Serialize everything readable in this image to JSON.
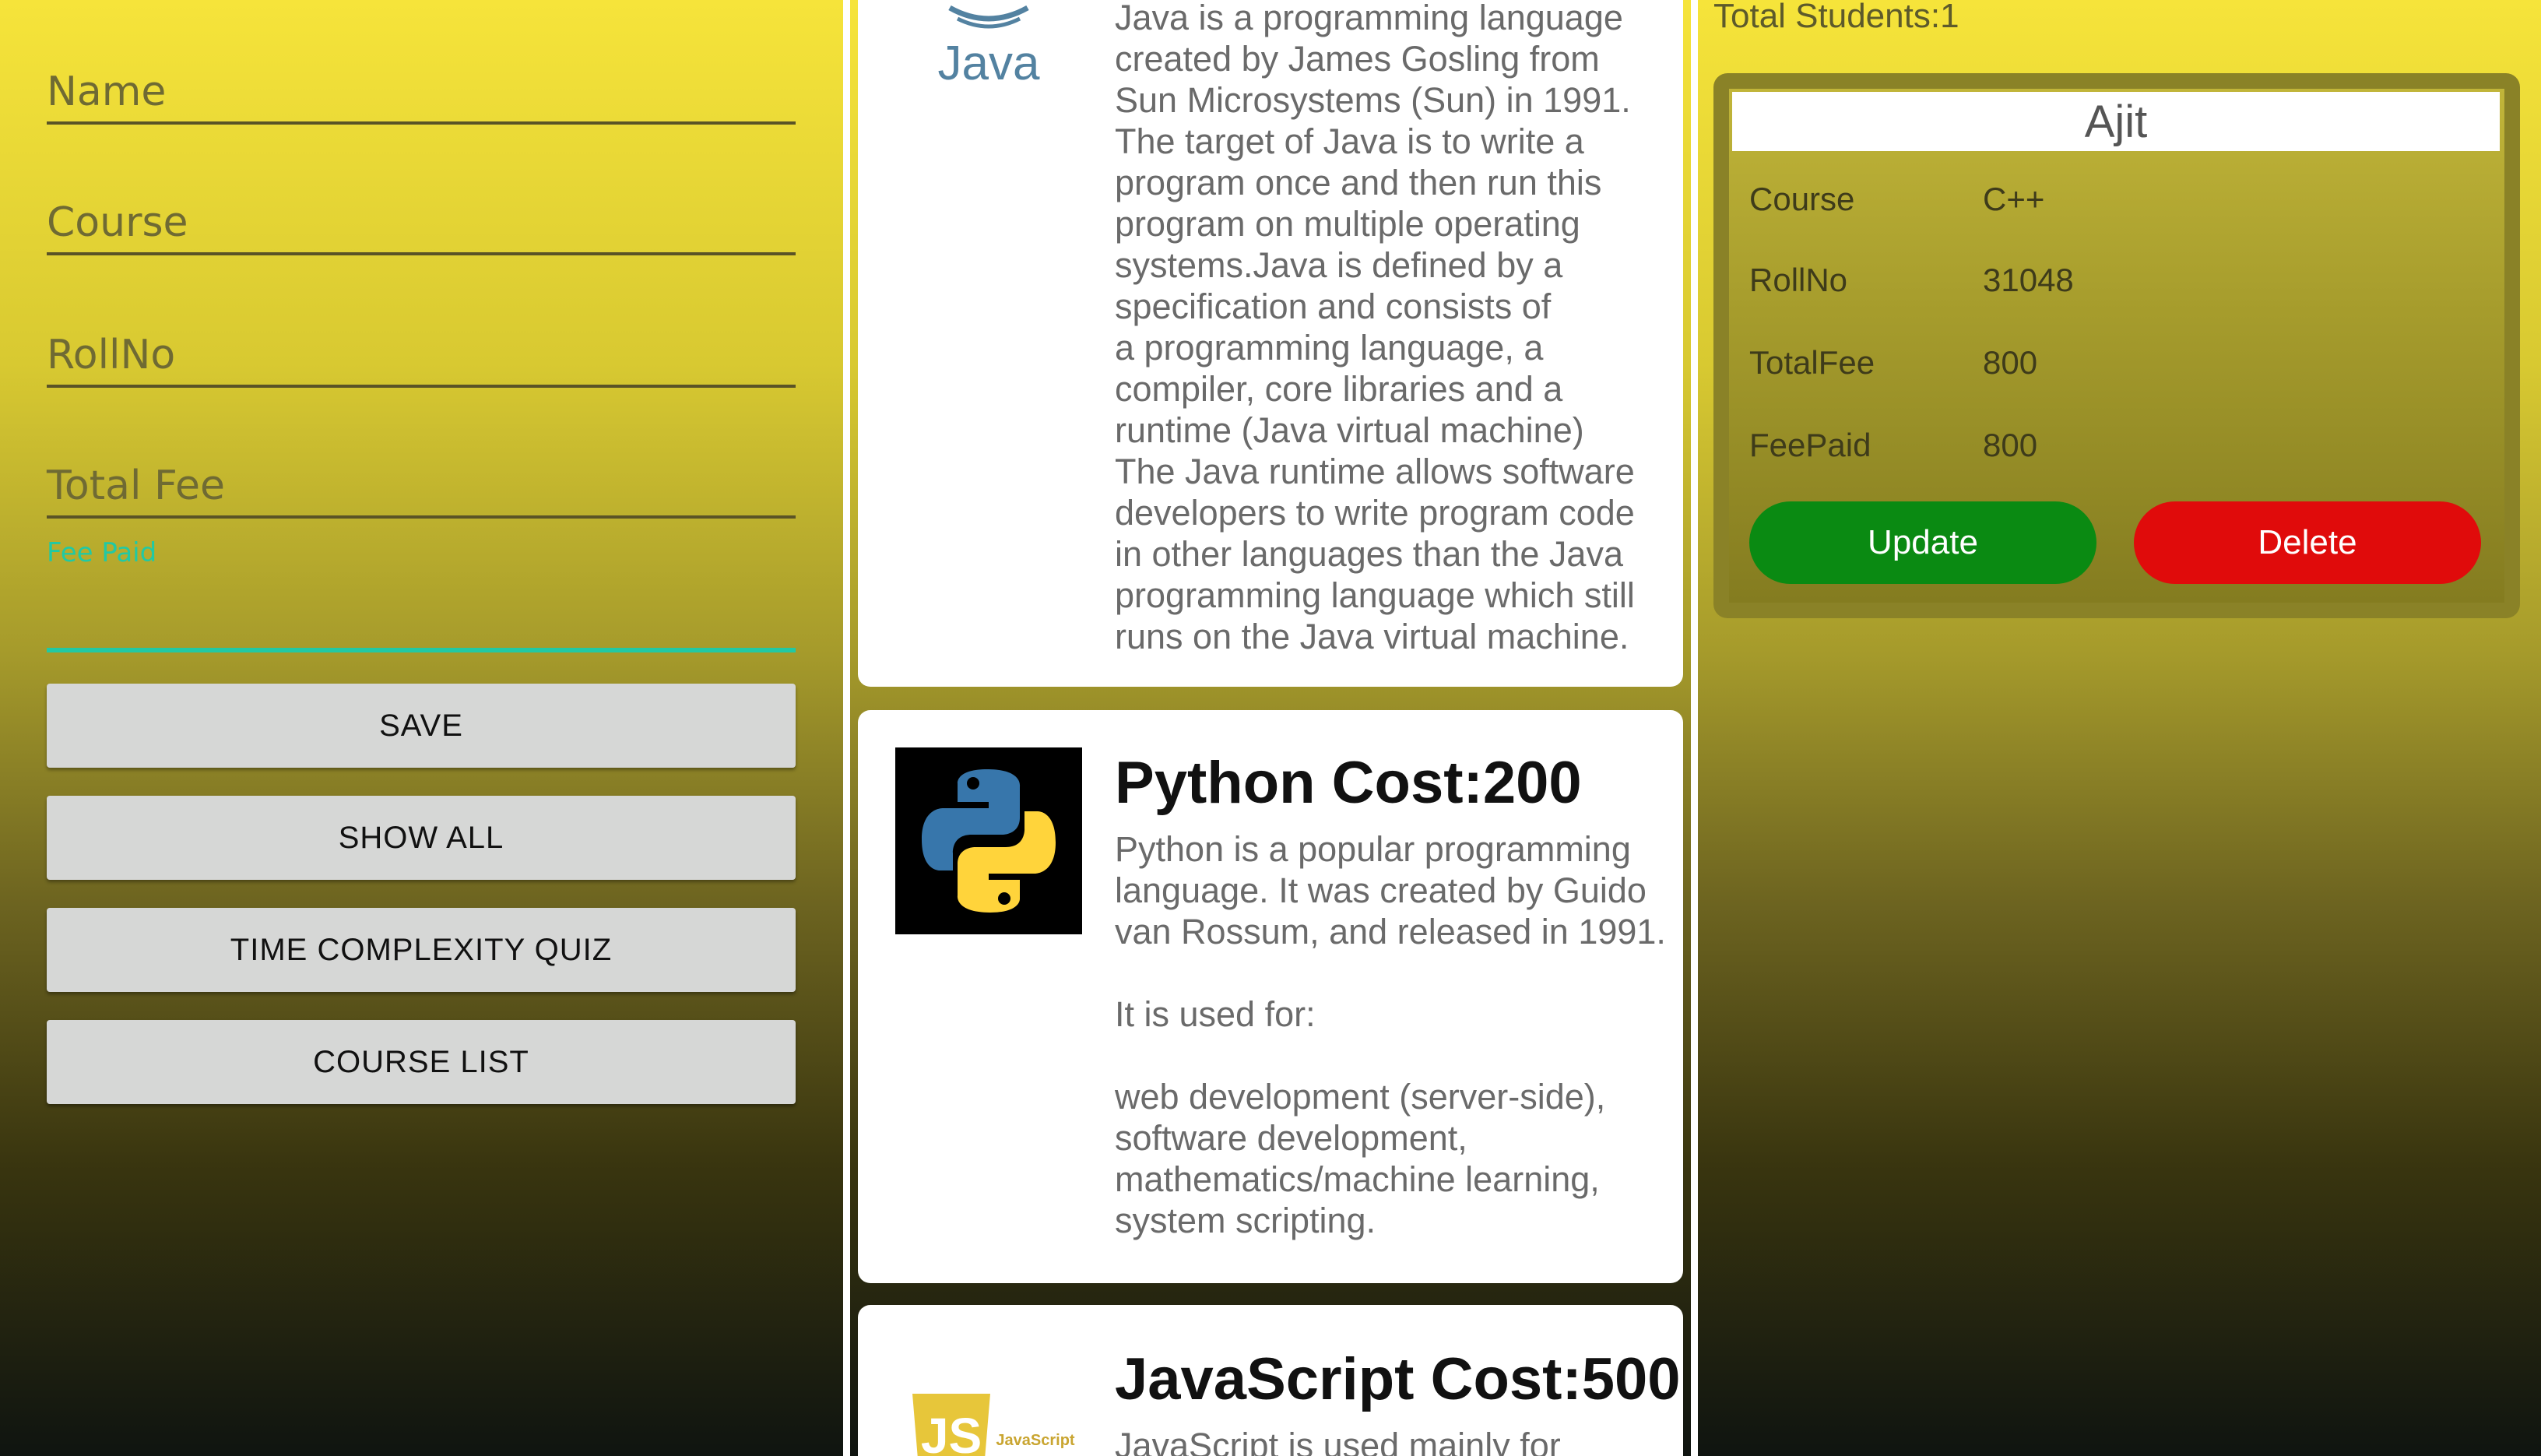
{
  "form": {
    "name_placeholder": "Name",
    "course_placeholder": "Course",
    "rollno_placeholder": "RollNo",
    "totalfee_placeholder": "Total Fee",
    "feepaid_label": "Fee Paid",
    "buttons": {
      "save": "SAVE",
      "show_all": "SHOW ALL",
      "quiz": "TIME COMPLEXITY QUIZ",
      "course_list": "COURSE LIST"
    },
    "accent_color": "#21c9a3"
  },
  "courses": [
    {
      "logo_text": "Java",
      "title": "",
      "description": "Java is a programming language\ncreated by James Gosling from\nSun Microsystems (Sun) in 1991.\nThe target of Java is to write a\nprogram once and then run this\nprogram on multiple operating\nsystems.Java is defined by a\nspecification and consists of\na programming language, a\ncompiler, core libraries and a\nruntime (Java virtual machine)\nThe Java runtime allows software\ndevelopers to write program code\nin other languages than the Java\nprogramming language which still\nruns on the Java virtual machine."
    },
    {
      "logo_icon": "python-logo-icon",
      "title": "Python Cost:200",
      "description": "Python is a popular programming\nlanguage. It was created by Guido\nvan Rossum, and released in 1991.\n\nIt is used for:\n\nweb development (server-side),\nsoftware development,\nmathematics/machine learning,\nsystem scripting."
    },
    {
      "logo_text": "JS",
      "logo_subtext": "JavaScript",
      "title": "JavaScript Cost:500",
      "description": "JavaScript is used mainly for"
    }
  ],
  "students": {
    "total_label": "Total Students:1",
    "card": {
      "name": "Ajit",
      "fields": [
        {
          "label": "Course",
          "value": "C++"
        },
        {
          "label": "RollNo",
          "value": "31048"
        },
        {
          "label": "TotalFee",
          "value": "800"
        },
        {
          "label": "FeePaid",
          "value": "800"
        }
      ],
      "update_label": "Update",
      "delete_label": "Delete",
      "update_color": "#0a8a12",
      "delete_color": "#e00b0b"
    }
  }
}
